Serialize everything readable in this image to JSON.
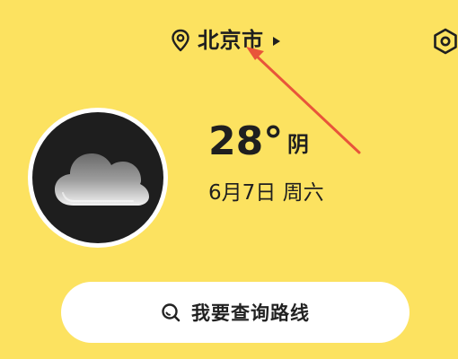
{
  "header": {
    "city": "北京市",
    "location_icon": "location-pin-icon",
    "dropdown_icon": "caret-right-icon",
    "settings_icon": "settings-hexagon-icon"
  },
  "weather": {
    "temperature": "28°",
    "condition": "阴",
    "date": "6月7日 周六",
    "icon": "cloud-icon"
  },
  "route_search": {
    "label": "我要查询路线",
    "icon": "search-icon"
  },
  "colors": {
    "background": "#FCE260",
    "annotation_arrow": "#E8553A",
    "button_background": "#FFFFFF",
    "icon_circle": "#1E1E1E"
  }
}
